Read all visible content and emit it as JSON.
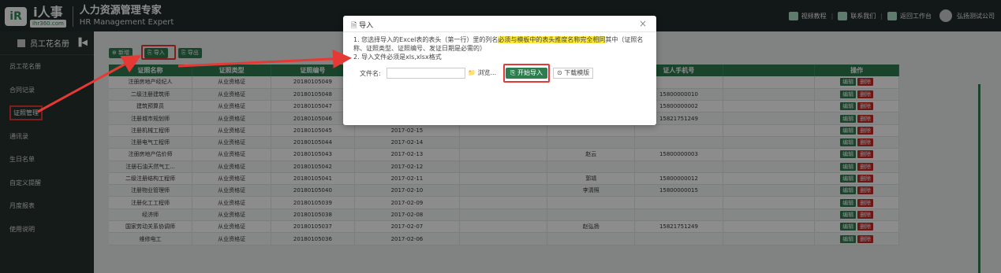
{
  "header": {
    "logo_mark": "iR",
    "logo_brand": "i人事",
    "logo_url": "ihr360.com",
    "title_cn": "人力资源管理专家",
    "title_en": "HR Management Expert",
    "links": [
      "视频教程",
      "联系我们",
      "返回工作台"
    ],
    "company": "弘扬测试公司"
  },
  "sidebar": {
    "title": "员工花名册",
    "items": [
      "员工花名册",
      "合同记录",
      "证照管理",
      "通讯录",
      "生日名单",
      "自定义提醒",
      "月度报表",
      "使用说明"
    ]
  },
  "toolbar": {
    "add": "新增",
    "import": "导入",
    "export": "导出"
  },
  "table": {
    "headers": [
      "证照名称",
      "证照类型",
      "证照编号",
      "",
      "",
      "",
      "证人手机号",
      "",
      "操作"
    ],
    "edit_label": "编辑",
    "delete_label": "删除",
    "rows": [
      [
        "注册房地产经纪人",
        "从业资格证",
        "20180105049",
        "",
        "",
        "",
        "",
        ""
      ],
      [
        "二级注册建筑师",
        "从业资格证",
        "20180105048",
        "",
        "",
        "",
        "15800000010",
        ""
      ],
      [
        "建筑预算员",
        "从业资格证",
        "20180105047",
        "",
        "",
        "",
        "15800000002",
        ""
      ],
      [
        "注册城市规划师",
        "从业资格证",
        "20180105046",
        "2017-02-16",
        "",
        "赵弘扬",
        "15821751249",
        ""
      ],
      [
        "注册机械工程师",
        "从业资格证",
        "20180105045",
        "2017-02-15",
        "",
        "",
        "",
        ""
      ],
      [
        "注册电气工程师",
        "从业资格证",
        "20180105044",
        "2017-02-14",
        "",
        "",
        "",
        ""
      ],
      [
        "注册房地产估价师",
        "从业资格证",
        "20180105043",
        "2017-02-13",
        "",
        "赵云",
        "15800000003",
        ""
      ],
      [
        "注册石油天然气工...",
        "从业资格证",
        "20180105042",
        "2017-02-12",
        "",
        "",
        "",
        ""
      ],
      [
        "二级注册结构工程师",
        "从业资格证",
        "20180105041",
        "2017-02-11",
        "",
        "郭靖",
        "15800000012",
        ""
      ],
      [
        "注册物业管理师",
        "从业资格证",
        "20180105040",
        "2017-02-10",
        "",
        "李清照",
        "15800000015",
        ""
      ],
      [
        "注册化工工程师",
        "从业资格证",
        "20180105039",
        "2017-02-09",
        "",
        "",
        "",
        ""
      ],
      [
        "经济师",
        "从业资格证",
        "20180105038",
        "2017-02-08",
        "",
        "",
        "",
        ""
      ],
      [
        "国家劳动关系协调师",
        "从业资格证",
        "20180105037",
        "2017-02-07",
        "",
        "赵弘扬",
        "15821751249",
        ""
      ],
      [
        "维修电工",
        "从业资格证",
        "20180105036",
        "2017-02-06",
        "",
        "",
        "",
        ""
      ]
    ]
  },
  "modal": {
    "title": "导入",
    "close": "×",
    "line1_a": "1. 您选择导入的Excel表的表头（第一行）里的列名",
    "line1_mark": "必须与模板中的表头推度名称完全相同",
    "line1_b": "其中（证照名称、证照类型、证照编号、发证日期是必需的）",
    "line2": "2. 导入文件必须是xls,xlsx格式",
    "file_label": "文件名:",
    "browse": "浏览...",
    "import_btn": "开始导入",
    "download": "下载模版"
  },
  "colors": {
    "header_bg": "#1f2d2a",
    "sidebar_bg": "#26322f",
    "accent": "#2e7d4f",
    "delete": "#c62828",
    "annotation": "#e53935",
    "highlight": "#ffeb3b"
  }
}
